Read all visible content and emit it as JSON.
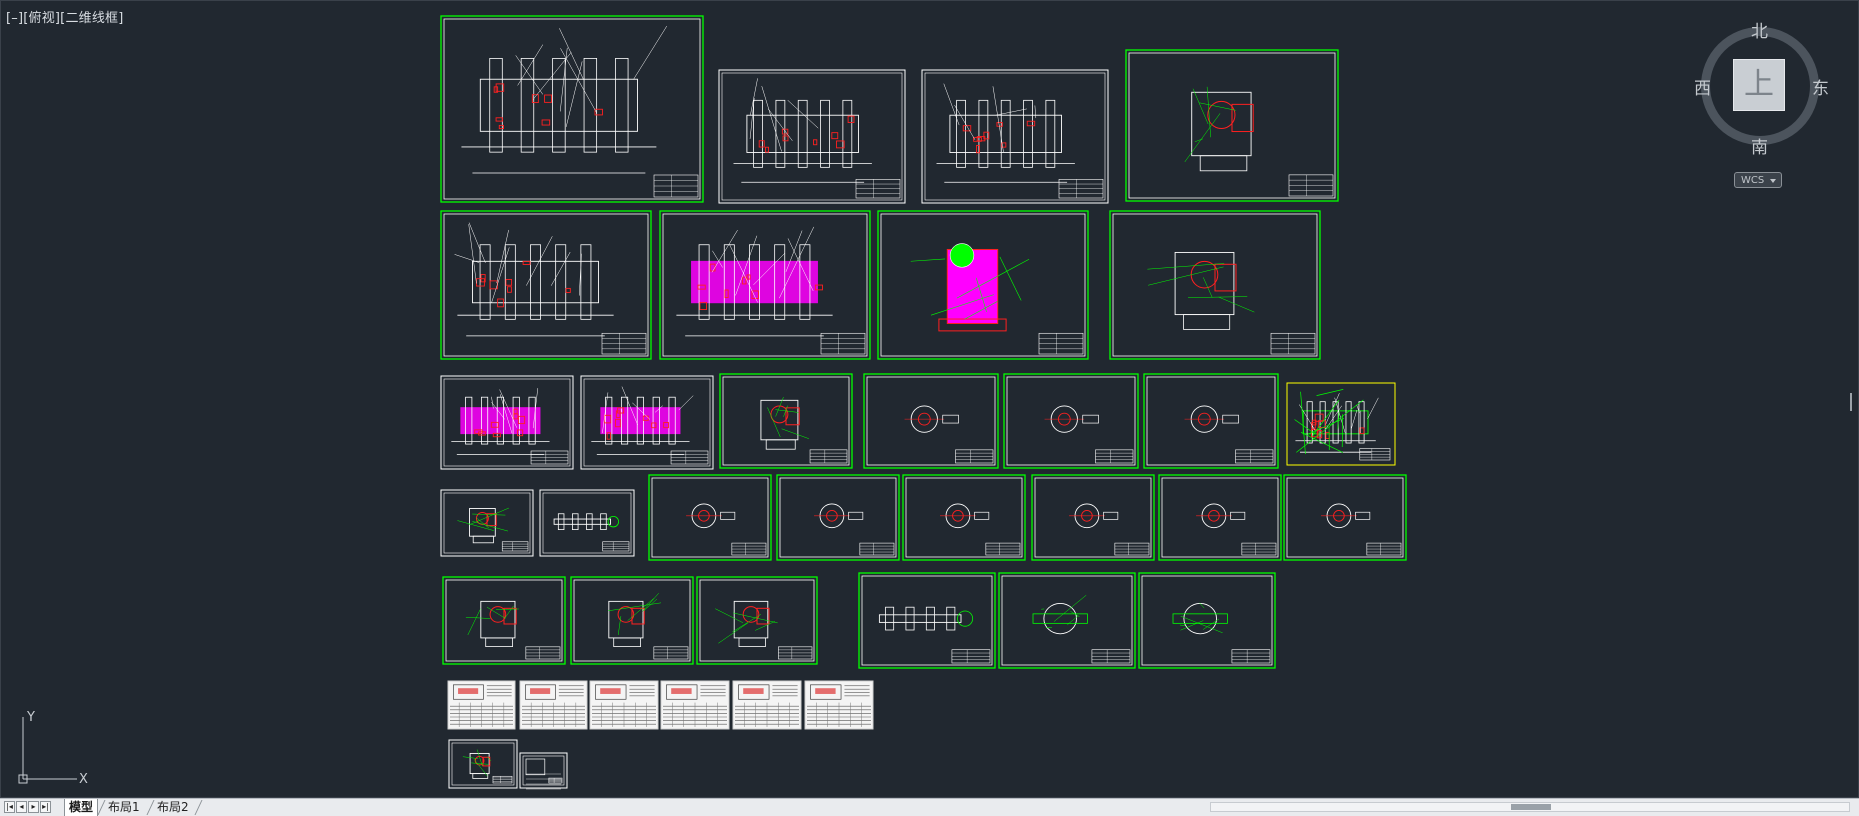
{
  "viewport": {
    "view_label": "[–][俯视][二维线框]"
  },
  "viewcube": {
    "top_face": "上",
    "north": "北",
    "south": "南",
    "west": "西",
    "east": "东",
    "wcs_label": "WCS"
  },
  "ucs": {
    "x_label": "X",
    "y_label": "Y"
  },
  "tabs": {
    "model": "模型",
    "layout1": "布局1",
    "layout2": "布局2"
  },
  "colors": {
    "background": "#212830",
    "frame": "#00ff00",
    "paper": "#ffffff",
    "red": "#ff2020",
    "magenta": "#ff00ff",
    "yellow": "#ffff00"
  },
  "sheets": [
    {
      "id": "s01",
      "frame": "green",
      "content": "assembly",
      "density": "high"
    },
    {
      "id": "s02",
      "frame": "white",
      "content": "assembly",
      "density": "medium"
    },
    {
      "id": "s03",
      "frame": "white",
      "content": "assembly",
      "density": "medium"
    },
    {
      "id": "s04",
      "frame": "green",
      "content": "part",
      "density": "medium"
    },
    {
      "id": "s05",
      "frame": "green",
      "content": "assembly",
      "density": "high"
    },
    {
      "id": "s06",
      "frame": "green",
      "content": "magenta-assembly",
      "density": "high"
    },
    {
      "id": "s07",
      "frame": "green",
      "content": "magenta-part",
      "density": "high"
    },
    {
      "id": "s08",
      "frame": "green",
      "content": "part",
      "density": "high"
    },
    {
      "id": "s09",
      "frame": "white",
      "content": "magenta-assembly",
      "density": "medium"
    },
    {
      "id": "s10",
      "frame": "white",
      "content": "magenta-assembly",
      "density": "medium"
    },
    {
      "id": "s11",
      "frame": "green",
      "content": "views",
      "density": "medium"
    },
    {
      "id": "s12",
      "frame": "green",
      "content": "small-part",
      "density": "low"
    },
    {
      "id": "s13",
      "frame": "green",
      "content": "small-part",
      "density": "low"
    },
    {
      "id": "s14",
      "frame": "green",
      "content": "small-part",
      "density": "low"
    },
    {
      "id": "s15",
      "frame": "yellow",
      "content": "green-assembly",
      "density": "high"
    },
    {
      "id": "s16",
      "frame": "white",
      "content": "part",
      "density": "medium"
    },
    {
      "id": "s17",
      "frame": "white",
      "content": "shaft",
      "density": "low"
    },
    {
      "id": "s18",
      "frame": "green",
      "content": "small-part",
      "density": "low"
    },
    {
      "id": "s19",
      "frame": "green",
      "content": "small-part",
      "density": "low"
    },
    {
      "id": "s20",
      "frame": "green",
      "content": "small-part",
      "density": "low"
    },
    {
      "id": "s21",
      "frame": "green",
      "content": "small-part",
      "density": "low"
    },
    {
      "id": "s22",
      "frame": "green",
      "content": "small-part",
      "density": "low"
    },
    {
      "id": "s23",
      "frame": "green",
      "content": "small-part",
      "density": "low"
    },
    {
      "id": "s24",
      "frame": "green",
      "content": "part",
      "density": "low"
    },
    {
      "id": "s25",
      "frame": "green",
      "content": "part",
      "density": "medium"
    },
    {
      "id": "s26",
      "frame": "green",
      "content": "part",
      "density": "medium"
    },
    {
      "id": "s27",
      "frame": "green",
      "content": "shaft",
      "density": "medium"
    },
    {
      "id": "s28",
      "frame": "green",
      "content": "green-part",
      "density": "medium"
    },
    {
      "id": "s29",
      "frame": "green",
      "content": "green-part",
      "density": "medium"
    },
    {
      "id": "s30",
      "frame": "paper",
      "content": "process-card",
      "density": "high"
    },
    {
      "id": "s31",
      "frame": "paper",
      "content": "process-card",
      "density": "high"
    },
    {
      "id": "s32",
      "frame": "paper",
      "content": "process-card",
      "density": "high"
    },
    {
      "id": "s33",
      "frame": "paper",
      "content": "process-card",
      "density": "high"
    },
    {
      "id": "s34",
      "frame": "paper",
      "content": "process-card",
      "density": "high"
    },
    {
      "id": "s35",
      "frame": "paper",
      "content": "process-card",
      "density": "high"
    },
    {
      "id": "s36",
      "frame": "white",
      "content": "part",
      "density": "low"
    },
    {
      "id": "s37",
      "frame": "white",
      "content": "process-card",
      "density": "low"
    }
  ]
}
